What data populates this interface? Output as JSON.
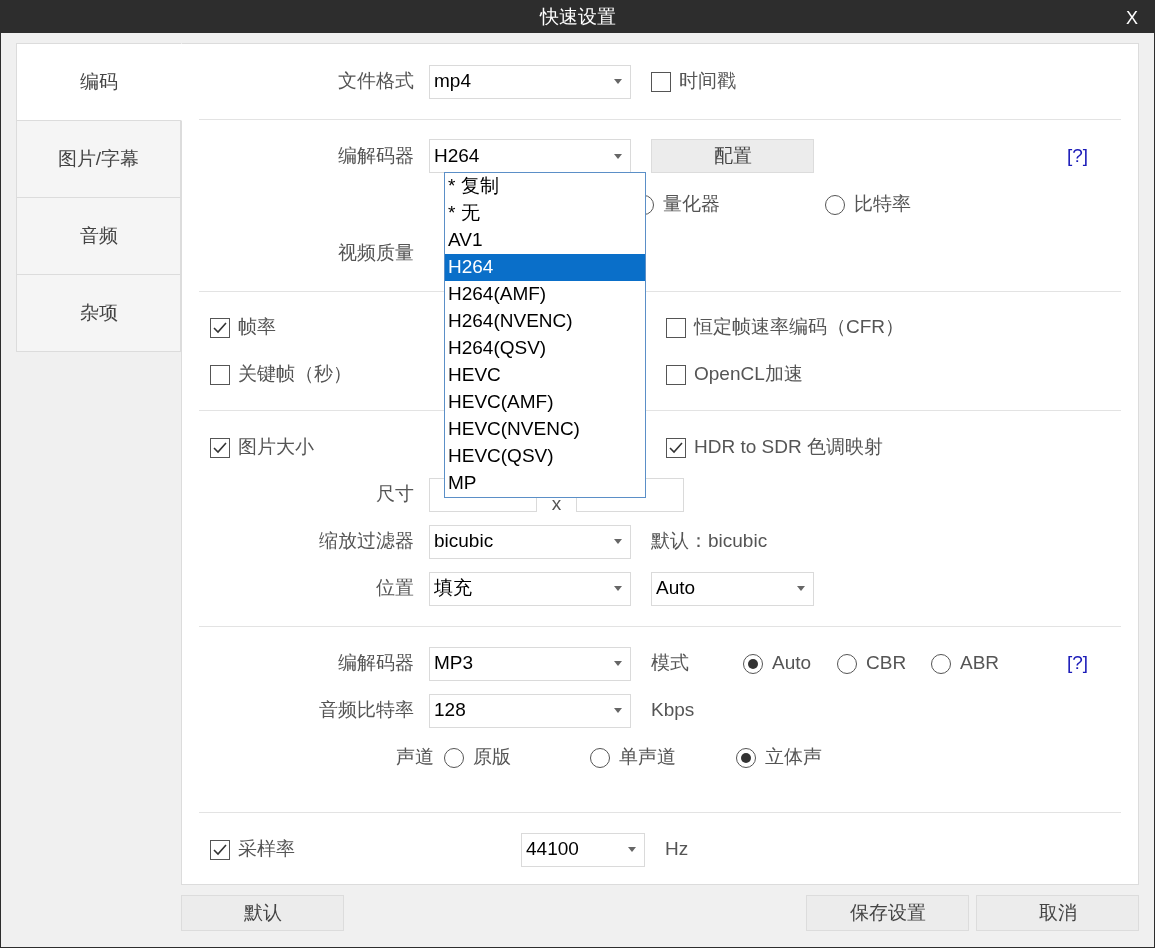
{
  "window": {
    "title": "快速设置",
    "close": "X"
  },
  "tabs": [
    {
      "label": "编码",
      "selected": true
    },
    {
      "label": "图片/字幕",
      "selected": false
    },
    {
      "label": "音频",
      "selected": false
    },
    {
      "label": "杂项",
      "selected": false
    }
  ],
  "video": {
    "format": {
      "label": "文件格式",
      "value": "mp4"
    },
    "timestamp": {
      "label": "时间戳",
      "checked": false
    },
    "codec": {
      "label": "编解码器",
      "value": "H264",
      "configure": "配置",
      "help": "[?]",
      "options": [
        {
          "label": "* 复制",
          "selected": false
        },
        {
          "label": "* 无",
          "selected": false
        },
        {
          "label": "AV1",
          "selected": false
        },
        {
          "label": "H264",
          "selected": true
        },
        {
          "label": "H264(AMF)",
          "selected": false
        },
        {
          "label": "H264(NVENC)",
          "selected": false
        },
        {
          "label": "H264(QSV)",
          "selected": false
        },
        {
          "label": "HEVC",
          "selected": false
        },
        {
          "label": "HEVC(AMF)",
          "selected": false
        },
        {
          "label": "HEVC(NVENC)",
          "selected": false
        },
        {
          "label": "HEVC(QSV)",
          "selected": false
        },
        {
          "label": "MP",
          "selected": false
        }
      ]
    },
    "rate_modes": [
      {
        "label": "量化器",
        "selected": false
      },
      {
        "label": "比特率",
        "selected": false
      }
    ],
    "quality": {
      "label": "视频质量"
    }
  },
  "frame": {
    "framerate": {
      "label": "帧率",
      "checked": true
    },
    "cfr": {
      "label": "恒定帧速率编码（CFR）",
      "checked": false
    },
    "keyframe": {
      "label": "关键帧（秒）",
      "checked": false
    },
    "opencl": {
      "label": "OpenCL加速",
      "checked": false
    }
  },
  "picture": {
    "resize": {
      "label": "图片大小",
      "checked": true
    },
    "hdr": {
      "label": "HDR to SDR 色调映射",
      "checked": true
    },
    "size": {
      "label": "尺寸",
      "separator": "x"
    },
    "filter": {
      "label": "缩放过滤器",
      "value": "bicubic",
      "default": "默认：bicubic"
    },
    "position": {
      "label": "位置",
      "value": "填充",
      "anchor": "Auto"
    }
  },
  "audio": {
    "codec": {
      "label": "编解码器",
      "value": "MP3"
    },
    "mode": {
      "label": "模式",
      "options": [
        {
          "label": "Auto",
          "selected": true
        },
        {
          "label": "CBR",
          "selected": false
        },
        {
          "label": "ABR",
          "selected": false
        }
      ]
    },
    "help": "[?]",
    "bitrate": {
      "label": "音频比特率",
      "value": "128",
      "unit": "Kbps"
    },
    "channels": {
      "label": "声道",
      "options": [
        {
          "label": "原版",
          "selected": false
        },
        {
          "label": "单声道",
          "selected": false
        },
        {
          "label": "立体声",
          "selected": true
        }
      ]
    },
    "samplerate": {
      "label": "采样率",
      "checked": true,
      "value": "44100",
      "unit": "Hz"
    }
  },
  "buttons": [
    {
      "kind": "default",
      "label": "默认"
    },
    {
      "kind": "save",
      "label": "保存设置"
    },
    {
      "kind": "cancel",
      "label": "取消"
    }
  ]
}
